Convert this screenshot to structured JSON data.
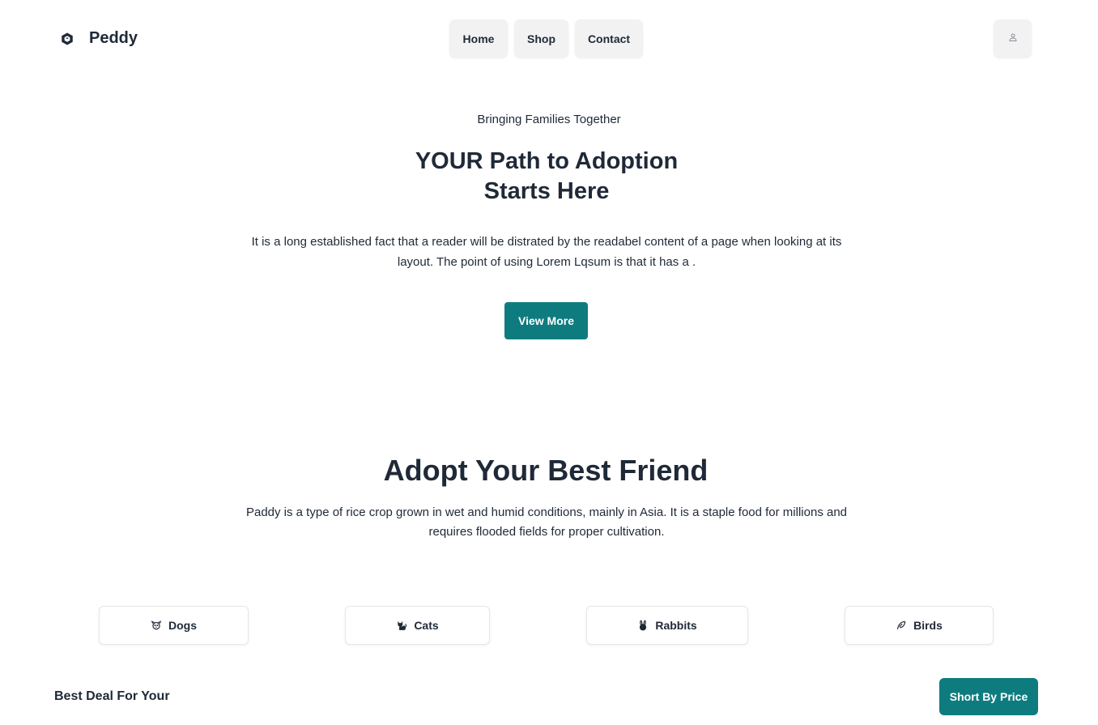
{
  "brand": {
    "name": "Peddy",
    "icon": "hexagon-cube-icon"
  },
  "nav": {
    "home": "Home",
    "shop": "Shop",
    "contact": "Contact",
    "user_icon": "user-icon"
  },
  "hero": {
    "eyebrow": "Bringing Families Together",
    "title_line1": "YOUR Path to Adoption",
    "title_line2": "Starts Here",
    "description": "It is a long established fact that a reader will be distrated by the readabel content of a page when looking at its layout. The point of using Lorem Lqsum is that it has a .",
    "button": "View More"
  },
  "adopt": {
    "title": "Adopt Your Best Friend",
    "description": "Paddy is a type of rice crop grown in wet and humid conditions, mainly in Asia. It is a staple food for millions and requires flooded fields for proper cultivation.",
    "categories": [
      {
        "label": "Dogs",
        "icon": "dog-icon"
      },
      {
        "label": "Cats",
        "icon": "cat-icon"
      },
      {
        "label": "Rabbits",
        "icon": "rabbit-icon"
      },
      {
        "label": "Birds",
        "icon": "bird-icon"
      }
    ]
  },
  "deals": {
    "title": "Best Deal For Your",
    "sort_button": "Short By Price"
  },
  "colors": {
    "accent": "#0e7c7f",
    "text": "#1f2937",
    "nav_bg": "#f2f2f2"
  }
}
